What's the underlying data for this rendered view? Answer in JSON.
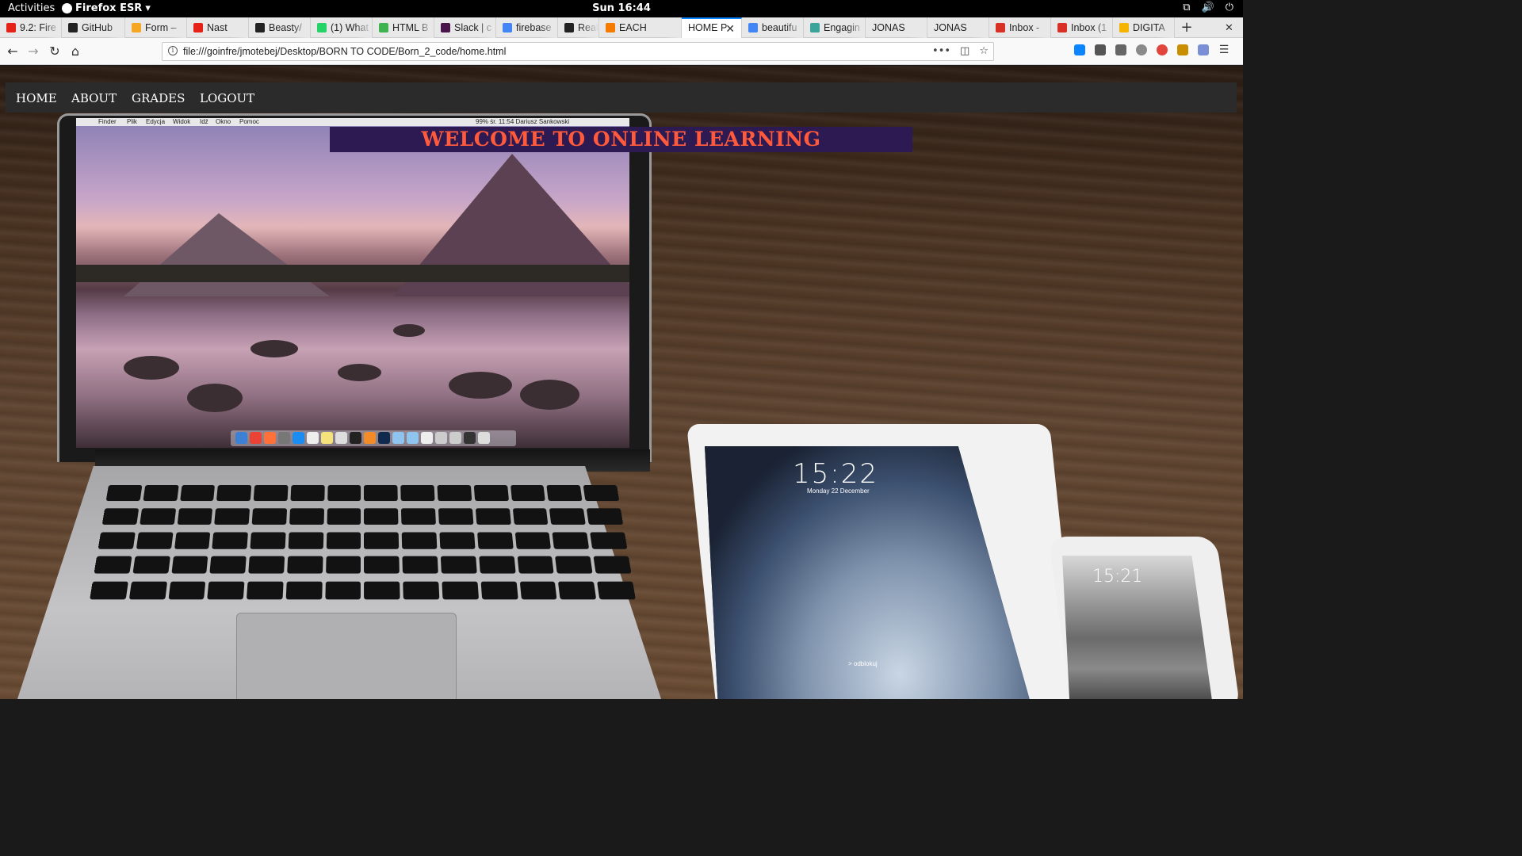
{
  "system": {
    "activities": "Activities",
    "app_name": "Firefox ESR",
    "clock": "Sun 16:44"
  },
  "tabs": [
    {
      "title": "9.2: Fire",
      "color": "#e62117"
    },
    {
      "title": "GitHub",
      "color": "#222222"
    },
    {
      "title": "Form –",
      "color": "#f5a623"
    },
    {
      "title": "Nast",
      "color": "#e62117"
    },
    {
      "title": "Beasty/",
      "color": "#222222"
    },
    {
      "title": "(1) What",
      "color": "#25d366"
    },
    {
      "title": "HTML B",
      "color": "#3fb34f"
    },
    {
      "title": "Slack | c",
      "color": "#4a154b"
    },
    {
      "title": "firebase",
      "color": "#4285f4"
    },
    {
      "title": "Real",
      "color": "#222222"
    },
    {
      "title": "EACH",
      "color": "#f57c00"
    },
    {
      "title": "HOME P",
      "color": "#ffffff"
    },
    {
      "title": "beautifu",
      "color": "#4285f4"
    },
    {
      "title": "Engagin",
      "color": "#3aa39a"
    },
    {
      "title": "JONAS",
      "color": "#e8e8e8"
    },
    {
      "title": "JONAS",
      "color": "#e8e8e8"
    },
    {
      "title": "Inbox -",
      "color": "#d93025"
    },
    {
      "title": "Inbox (1",
      "color": "#d93025"
    },
    {
      "title": "DIGITA",
      "color": "#f4b400"
    }
  ],
  "url": "file:///goinfre/jmotebej/Desktop/BORN TO CODE/Born_2_code/home.html",
  "site_nav": {
    "home": "HOME",
    "about": "ABOUT",
    "grades": "GRADES",
    "logout": "LOGOUT"
  },
  "welcome_text": "WELCOME TO ONLINE LEARNING",
  "hero_image": {
    "mac_menu": [
      "Finder",
      "Plik",
      "Edycja",
      "Widok",
      "Idź",
      "Okno",
      "Pomoc"
    ],
    "mac_status": "99%  śr. 11:54  Dariusz Sankowski",
    "ipad_time": "15:22",
    "ipad_date": "Monday 22 December",
    "ipad_unlock": "> odblokuj",
    "iphone_time": "15:21"
  },
  "colors": {
    "banner_bg": "#2d1a52",
    "banner_text": "#ff5a3c",
    "site_nav_bg": "#2b2b2b",
    "tab_accent": "#0a84ff"
  }
}
